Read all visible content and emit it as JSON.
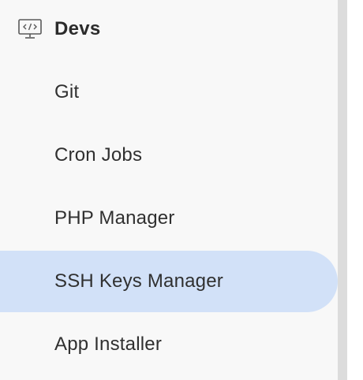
{
  "section": {
    "title": "Devs",
    "icon": "code-monitor-icon"
  },
  "menu": {
    "items": [
      {
        "label": "Git",
        "active": false
      },
      {
        "label": "Cron Jobs",
        "active": false
      },
      {
        "label": "PHP Manager",
        "active": false
      },
      {
        "label": "SSH Keys Manager",
        "active": true
      },
      {
        "label": "App Installer",
        "active": false
      }
    ]
  },
  "colors": {
    "active_background": "#d2e1f8",
    "sidebar_background": "#f8f8f8",
    "text": "#303030",
    "scrollbar": "#dcdcdc"
  }
}
